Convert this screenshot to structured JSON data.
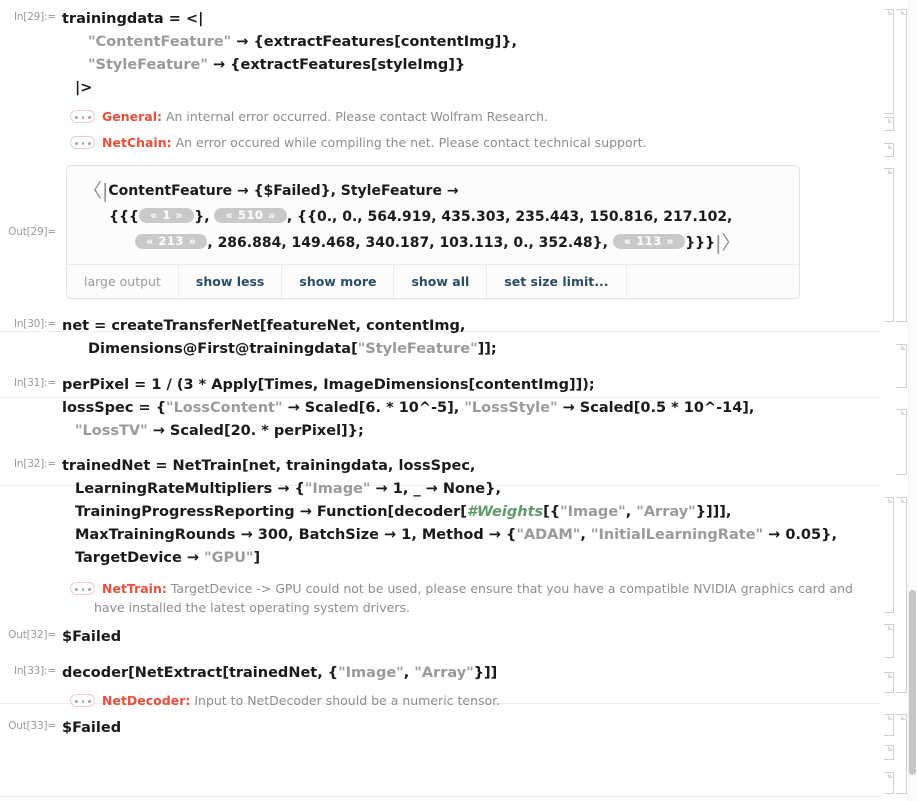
{
  "app": {
    "title": "Wolfram Notebook",
    "kind": "mathematica-notebook"
  },
  "cells": [
    {
      "id": "in29",
      "label": "In[29]:=",
      "type": "input",
      "lines": [
        "trainingdata = <|",
        "\"ContentFeature\" → {extractFeatures[contentImg]},",
        "\"StyleFeature\" → {extractFeatures[styleImg]}",
        "|>"
      ]
    },
    {
      "id": "msg-general",
      "type": "message",
      "name": "General:",
      "text": "An internal error occurred. Please contact Wolfram Research."
    },
    {
      "id": "msg-netchain",
      "type": "message",
      "name": "NetChain:",
      "text": "An error occured while compiling the net. Please contact technical support."
    },
    {
      "id": "out29",
      "label": "Out[29]=",
      "type": "large-output",
      "lines": [
        "ContentFeature → {$Failed}, StyleFeature →",
        "{{{ «1» }, «510» , {{0., 0., 564.919, 435.303, 235.443, 150.816, 217.102,",
        "«213» , 286.884, 149.468, 340.187, 103.113, 0., 352.48}, «113» }}}"
      ],
      "pills": [
        "« 1 »",
        "« 510 »",
        "« 213 »",
        "« 113 »"
      ],
      "toolbar": {
        "title": "large output",
        "buttons": [
          "show less",
          "show more",
          "show all",
          "set size limit..."
        ]
      }
    },
    {
      "id": "in30",
      "label": "In[30]:=",
      "type": "input",
      "lines": [
        "net = createTransferNet[featureNet, contentImg,",
        "Dimensions@First@trainingdata[\"StyleFeature\"]];"
      ]
    },
    {
      "id": "in31",
      "label": "In[31]:=",
      "type": "input",
      "lines": [
        "perPixel = 1 / (3 * Apply[Times, ImageDimensions[contentImg]]);",
        "lossSpec = {\"LossContent\" → Scaled[6. * 10^-5], \"LossStyle\" → Scaled[0.5 * 10^-14],",
        "\"LossTV\" → Scaled[20. * perPixel]};"
      ]
    },
    {
      "id": "in32",
      "label": "In[32]:=",
      "type": "input",
      "lines": [
        "trainedNet = NetTrain[net, trainingdata, lossSpec,",
        "LearningRateMultipliers → {\"Image\" → 1, _ → None},",
        "TrainingProgressReporting → Function[decoder[#Weights[{\"Image\", \"Array\"}]]],",
        "MaxTrainingRounds → 300, BatchSize → 1, Method → {\"ADAM\", \"InitialLearningRate\" → 0.05},",
        "TargetDevice → \"GPU\"]"
      ]
    },
    {
      "id": "msg-nettrain",
      "type": "message",
      "name": "NetTrain:",
      "text": "TargetDevice -> GPU could not be used, please ensure that you have a compatible NVIDIA graphics card and",
      "text2": "have installed the latest operating system drivers."
    },
    {
      "id": "out32",
      "label": "Out[32]=",
      "type": "output",
      "value": "$Failed"
    },
    {
      "id": "in33",
      "label": "In[33]:=",
      "type": "input",
      "lines": [
        "decoder[NetExtract[trainedNet, {\"Image\", \"Array\"}]]"
      ]
    },
    {
      "id": "msg-netdecoder",
      "type": "message",
      "name": "NetDecoder:",
      "text": "Input to NetDecoder should be a numeric tensor."
    },
    {
      "id": "out33",
      "label": "Out[33]=",
      "type": "output",
      "value": "$Failed"
    }
  ],
  "in29": {
    "label": "In[29]:=",
    "l0": "trainingdata = <|",
    "l1a": "\"ContentFeature\"",
    "l1b": " → {extractFeatures[contentImg]},",
    "l2a": "\"StyleFeature\"",
    "l2b": " → {extractFeatures[styleImg]}",
    "l3": "|>"
  },
  "msg_general": {
    "name": "General:",
    "text": "An internal error occurred. Please contact Wolfram Research."
  },
  "msg_netchain": {
    "name": "NetChain:",
    "text": "An error occured while compiling the net. Please contact technical support."
  },
  "out29": {
    "label": "Out[29]=",
    "open_angle": "〈|",
    "line1": "ContentFeature → {$Failed}, StyleFeature →",
    "l2_pre": "{{{",
    "pill1": "« 1 »",
    "l2_mid": "}, ",
    "pill2": "« 510 »",
    "l2_post": ", {{0., 0., 564.919, 435.303, 235.443, 150.816, 217.102,",
    "pill3": "« 213 »",
    "l3_mid": ", 286.884, 149.468, 340.187, 103.113, 0., 352.48}, ",
    "pill4": "« 113 »",
    "l3_post": "}}}",
    "close_angle": "|〉",
    "toolbar_title": "large output",
    "btn_show_less": "show less",
    "btn_show_more": "show more",
    "btn_show_all": "show all",
    "btn_set_size_limit": "set size limit..."
  },
  "in30": {
    "label": "In[30]:=",
    "l0": "net = createTransferNet[featureNet, contentImg,",
    "l1a": "Dimensions@First@trainingdata[",
    "l1b": "\"StyleFeature\"",
    "l1c": "]];"
  },
  "in31": {
    "label": "In[31]:=",
    "l0": "perPixel = 1 / (3 * Apply[Times, ImageDimensions[contentImg]]);",
    "l1a": "lossSpec = {",
    "l1b": "\"LossContent\"",
    "l1c": " → Scaled[6. * 10^-5], ",
    "l1d": "\"LossStyle\"",
    "l1e": " → Scaled[0.5 * 10^-14],",
    "l2a": "\"LossTV\"",
    "l2b": " → Scaled[20. * perPixel]};"
  },
  "in32": {
    "label": "In[32]:=",
    "l0": "trainedNet = NetTrain[net, trainingdata, lossSpec,",
    "l1a": "LearningRateMultipliers → {",
    "l1b": "\"Image\"",
    "l1c": " → 1, _ → None},",
    "l2a": "TrainingProgressReporting → Function[decoder[",
    "l2b": "#Weights",
    "l2c": "[{",
    "l2d": "\"Image\"",
    "l2e": ", ",
    "l2f": "\"Array\"",
    "l2g": "}]]],",
    "l3a": "MaxTrainingRounds → 300, BatchSize → 1, Method → {",
    "l3b": "\"ADAM\"",
    "l3c": ", ",
    "l3d": "\"InitialLearningRate\"",
    "l3e": " → 0.05},",
    "l4a": "TargetDevice → ",
    "l4b": "\"GPU\"",
    "l4c": "]"
  },
  "msg_nettrain": {
    "name": "NetTrain:",
    "text": "TargetDevice -> GPU could not be used, please ensure that you have a compatible NVIDIA graphics card and",
    "text2": "have installed the latest operating system drivers."
  },
  "out32": {
    "label": "Out[32]=",
    "value": "$Failed"
  },
  "in33": {
    "label": "In[33]:=",
    "l0a": "decoder[NetExtract[trainedNet, {",
    "l0b": "\"Image\"",
    "l0c": ", ",
    "l0d": "\"Array\"",
    "l0e": "}]]"
  },
  "msg_netdecoder": {
    "name": "NetDecoder:",
    "text": "Input to NetDecoder should be a numeric tensor."
  },
  "out33": {
    "label": "Out[33]=",
    "value": "$Failed"
  },
  "colors": {
    "message_name": "#e8503a",
    "message_text": "#8d8d8d",
    "string_literal": "#9a9a9a",
    "slot_token": "#5f9a6a",
    "code": "#1a1a1a",
    "label": "#9b9b9b",
    "toolbar_action": "#2a4d63",
    "pill_bg": "#c9c9c9",
    "bracket": "#cfcfcf"
  }
}
